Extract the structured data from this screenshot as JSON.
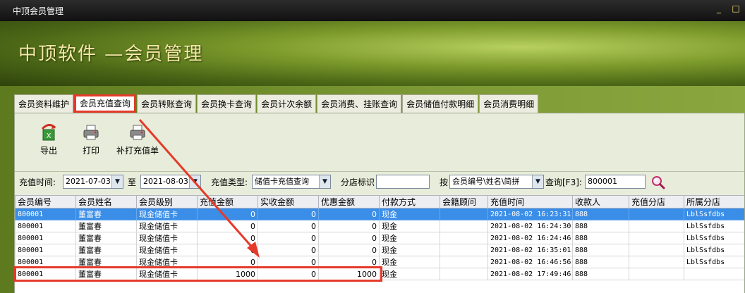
{
  "window": {
    "title": "中顶会员管理"
  },
  "banner": {
    "heading": "中顶软件 —会员管理"
  },
  "tabs": [
    {
      "label": "会员资料维护",
      "active": false
    },
    {
      "label": "会员充值查询",
      "active": true
    },
    {
      "label": "会员转账查询",
      "active": false
    },
    {
      "label": "会员换卡查询",
      "active": false
    },
    {
      "label": "会员计次余额",
      "active": false
    },
    {
      "label": "会员消费、挂账查询",
      "active": false
    },
    {
      "label": "会员储值付款明细",
      "active": false
    },
    {
      "label": "会员消费明细",
      "active": false
    }
  ],
  "toolbar": {
    "export_label": "导出",
    "print_label": "打印",
    "reprint_label": "补打充值单"
  },
  "filters": {
    "time_label": "充值时间:",
    "date_from": "2021-07-03",
    "to_label": "至",
    "date_to": "2021-08-03",
    "type_label": "充值类型:",
    "type_value": "储值卡充值查询",
    "store_label": "分店标识",
    "store_value": "",
    "by_label": "按",
    "by_value": "会员编号\\姓名\\简拼",
    "query_label": "查询[F3]:",
    "query_value": "800001"
  },
  "grid": {
    "columns": [
      "会员编号",
      "会员姓名",
      "会员级别",
      "充值金额",
      "实收金额",
      "优惠金额",
      "付款方式",
      "会籍顾问",
      "充值时间",
      "收款人",
      "充值分店",
      "所属分店"
    ],
    "rows": [
      [
        "800001",
        "董富春",
        "现金储值卡",
        "0",
        "0",
        "0",
        "现金",
        "",
        "2021-08-02 16:23:31",
        "888",
        "",
        "LblSsfdbs"
      ],
      [
        "800001",
        "董富春",
        "现金储值卡",
        "0",
        "0",
        "0",
        "现金",
        "",
        "2021-08-02 16:24:30",
        "888",
        "",
        "LblSsfdbs"
      ],
      [
        "800001",
        "董富春",
        "现金储值卡",
        "0",
        "0",
        "0",
        "现金",
        "",
        "2021-08-02 16:24:46",
        "888",
        "",
        "LblSsfdbs"
      ],
      [
        "800001",
        "董富春",
        "现金储值卡",
        "0",
        "0",
        "0",
        "现金",
        "",
        "2021-08-02 16:35:01",
        "888",
        "",
        "LblSsfdbs"
      ],
      [
        "800001",
        "董富春",
        "现金储值卡",
        "0",
        "0",
        "0",
        "现金",
        "",
        "2021-08-02 16:46:56",
        "888",
        "",
        "LblSsfdbs"
      ],
      [
        "800001",
        "董富春",
        "现金储值卡",
        "1000",
        "0",
        "1000",
        "现金",
        "",
        "2021-08-02 17:49:46",
        "888",
        "",
        ""
      ]
    ],
    "selected_row": 0
  },
  "colors": {
    "annotation": "#e53a2a",
    "selection": "#3b8ee8"
  }
}
